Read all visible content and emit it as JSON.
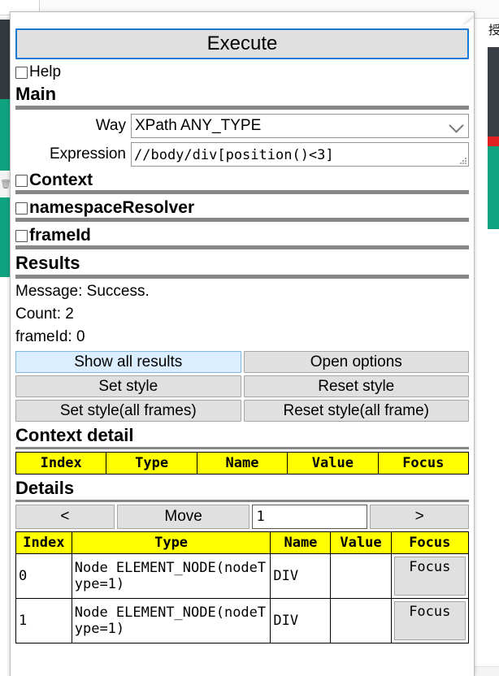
{
  "background": {
    "right_glyph": "授",
    "accent_dark": "#353a40",
    "accent_green": "#10a37f",
    "accent_red": "#e02020"
  },
  "panel": {
    "execute_label": "Execute",
    "help": {
      "label": "Help",
      "checked": false
    }
  },
  "main": {
    "section_title": "Main",
    "way": {
      "label": "Way",
      "value": "XPath ANY_TYPE",
      "chevron": "chevron-down-icon"
    },
    "expression": {
      "label": "Expression",
      "value": "//body/div[position()<3]"
    }
  },
  "toggles": [
    {
      "label": "Context",
      "checked": false
    },
    {
      "label": "namespaceResolver",
      "checked": false
    },
    {
      "label": "frameId",
      "checked": false
    }
  ],
  "results": {
    "section_title": "Results",
    "message": "Message: Success.",
    "count": "Count: 2",
    "frame_id": "frameId: 0",
    "buttons": [
      {
        "label": "Show all results",
        "highlighted": true
      },
      {
        "label": "Open options",
        "highlighted": false
      },
      {
        "label": "Set style",
        "highlighted": false
      },
      {
        "label": "Reset style",
        "highlighted": false
      },
      {
        "label": "Set style(all frames)",
        "highlighted": false
      },
      {
        "label": "Reset style(all frame)",
        "highlighted": false
      }
    ]
  },
  "context_detail": {
    "section_title": "Context detail",
    "headers": [
      "Index",
      "Type",
      "Name",
      "Value",
      "Focus"
    ],
    "rows": []
  },
  "details": {
    "section_title": "Details",
    "move": {
      "prev_label": "<",
      "move_label": "Move",
      "index_value": "1",
      "next_label": ">"
    },
    "headers": [
      "Index",
      "Type",
      "Name",
      "Value",
      "Focus"
    ],
    "rows": [
      {
        "index": "0",
        "type": "Node ELEMENT_NODE(nodeType=1)",
        "name": "DIV",
        "value": "",
        "focus_label": "Focus"
      },
      {
        "index": "1",
        "type": "Node ELEMENT_NODE(nodeType=1)",
        "name": "DIV",
        "value": "",
        "focus_label": "Focus"
      }
    ]
  }
}
